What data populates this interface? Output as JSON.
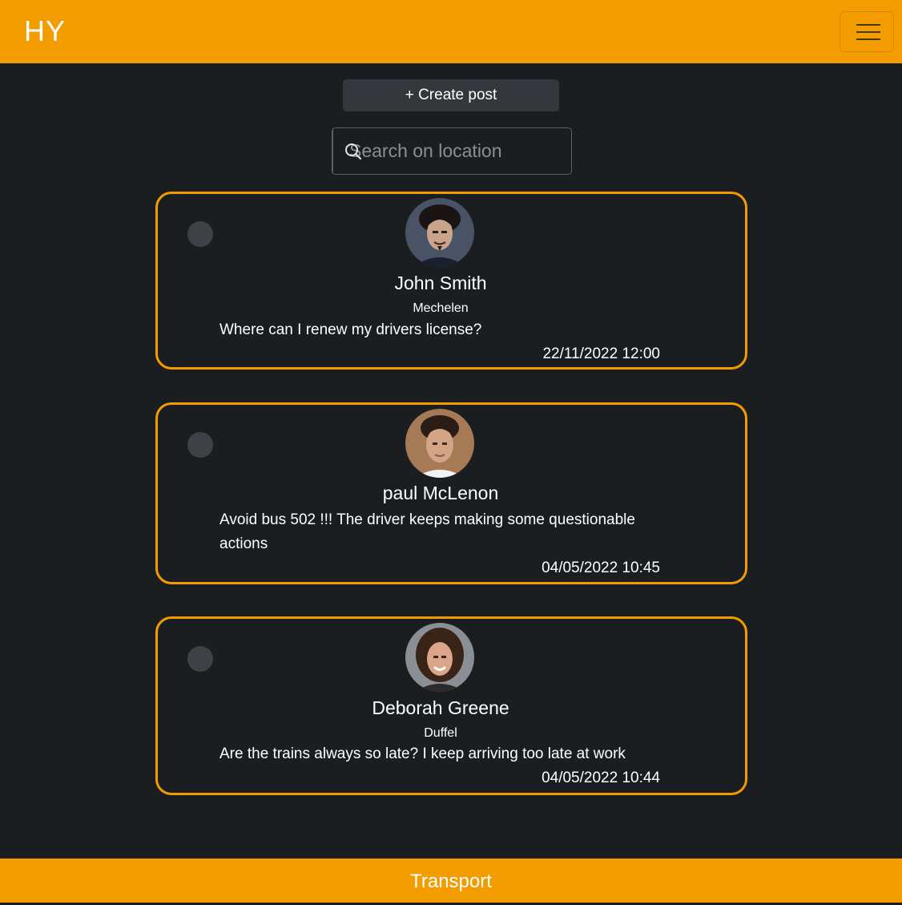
{
  "navbar": {
    "brand": "HY",
    "menu_icon": "hamburger-menu-icon",
    "color": "#f39c00"
  },
  "create_post": {
    "label": "+ Create post"
  },
  "search": {
    "placeholder": "Search on location",
    "value": "",
    "icon": "search-icon"
  },
  "posts": [
    {
      "author": "John Smith",
      "location": "Mechelen",
      "message": "Where can I renew my drivers license?",
      "timestamp": "22/11/2022 12:00"
    },
    {
      "author": "paul McLenon",
      "location": "",
      "message": "Avoid bus 502 !!! The driver keeps making some questionable actions",
      "timestamp": "04/05/2022 10:45"
    },
    {
      "author": "Deborah Greene",
      "location": "Duffel",
      "message": "Are the trains always so late? I keep arriving too late at work",
      "timestamp": "04/05/2022 10:44"
    }
  ],
  "footer": {
    "label": "Transport"
  },
  "colors": {
    "accent": "#f39c00",
    "background": "#1b1e21",
    "button": "#34383c"
  }
}
